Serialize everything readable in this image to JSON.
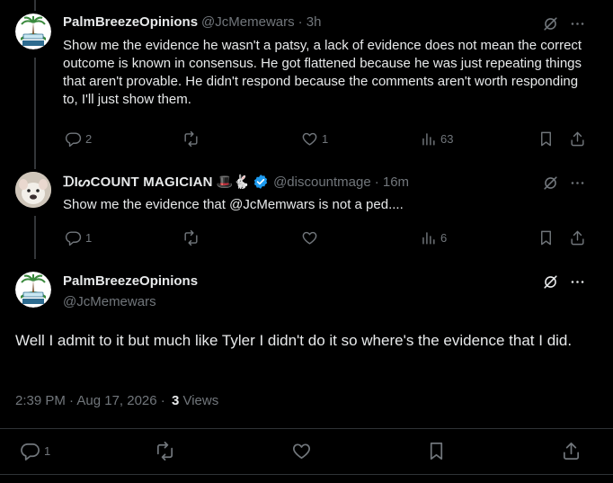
{
  "tweets": [
    {
      "display_name": "PalmBreezeOpinions",
      "handle": "@JcMemewars",
      "time": "· 3h",
      "text": "Show me the evidence he wasn't a patsy, a lack of evidence does not mean the correct outcome is known in consensus. He got flattened because he was just repeating things that aren't provable. He didn't respond because the comments aren't worth responding to, I'll just show them.",
      "replies": "2",
      "reposts": "",
      "likes": "1",
      "views": "63"
    },
    {
      "display_name": "DISCOUNT MAGICIAN",
      "display_name_styled": "ᗪIᔕCOUNT MAGICIAN",
      "emojis": "🎩🐇",
      "handle": "@discountmage",
      "time": "· 16m",
      "text": "Show me the evidence that @JcMemwars is not a ped....",
      "replies": "1",
      "reposts": "",
      "likes": "",
      "views": "6"
    }
  ],
  "main_tweet": {
    "display_name": "PalmBreezeOpinions",
    "handle": "@JcMemewars",
    "text": "Well I admit to it but much like Tyler I didn't do it so where's the evidence that I did.",
    "timestamp": "2:39 PM · Aug 17, 2026 ·",
    "views_count": "3",
    "views_label": "Views",
    "replies": "1"
  },
  "icons": {
    "grok": "grok-icon",
    "more": "more-icon",
    "reply": "reply-icon",
    "repost": "repost-icon",
    "like": "like-icon",
    "views": "views-icon",
    "bookmark": "bookmark-icon",
    "share": "share-icon",
    "verified": "verified-badge-icon"
  },
  "colors": {
    "background": "#000000",
    "text": "#e7e9ea",
    "muted": "#71767b",
    "verified": "#1d9bf0",
    "divider": "#2f3336"
  }
}
